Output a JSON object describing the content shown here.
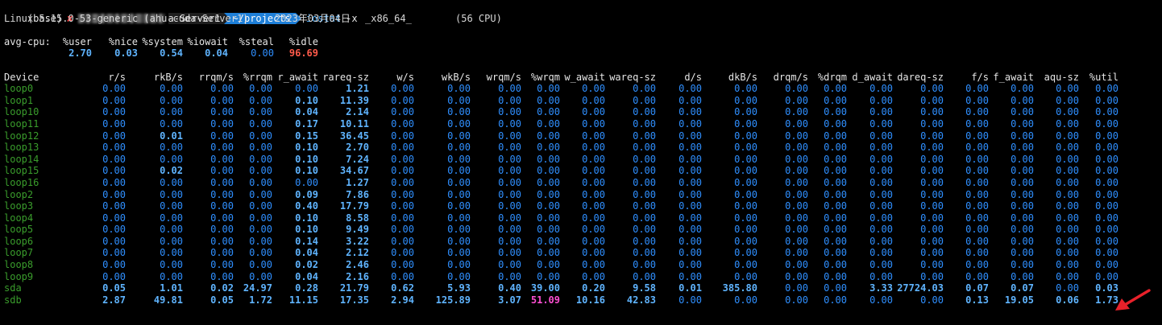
{
  "prompt": {
    "env": "(base)",
    "status_mark": "✘",
    "host_suffix": "a-Server1",
    "path": "~/projects",
    "command": "iostat",
    "args": "-x"
  },
  "sysinfo": {
    "kernel": "Linux 5.15.0-53-generic (ahu-cuda-Server1)",
    "date": "2023年03月04日",
    "arch": "_x86_64_",
    "cpus": "(56 CPU)"
  },
  "avgcpu": {
    "label": "avg-cpu:",
    "headers": [
      "%user",
      "%nice",
      "%system",
      "%iowait",
      "%steal",
      "%idle"
    ],
    "values": [
      "2.70",
      "0.03",
      "0.54",
      "0.04",
      "0.00",
      "96.69"
    ]
  },
  "device_header": "Device",
  "columns": [
    "r/s",
    "rkB/s",
    "rrqm/s",
    "%rrqm",
    "r_await",
    "rareq-sz",
    "w/s",
    "wkB/s",
    "wrqm/s",
    "%wrqm",
    "w_await",
    "wareq-sz",
    "d/s",
    "dkB/s",
    "drqm/s",
    "%drqm",
    "d_await",
    "dareq-sz",
    "f/s",
    "f_await",
    "aqu-sz",
    "%util"
  ],
  "devices": [
    {
      "name": "loop0",
      "v": [
        "0.00",
        "0.00",
        "0.00",
        "0.00",
        "0.00",
        "1.21",
        "0.00",
        "0.00",
        "0.00",
        "0.00",
        "0.00",
        "0.00",
        "0.00",
        "0.00",
        "0.00",
        "0.00",
        "0.00",
        "0.00",
        "0.00",
        "0.00",
        "0.00",
        "0.00"
      ]
    },
    {
      "name": "loop1",
      "v": [
        "0.00",
        "0.00",
        "0.00",
        "0.00",
        "0.10",
        "11.39",
        "0.00",
        "0.00",
        "0.00",
        "0.00",
        "0.00",
        "0.00",
        "0.00",
        "0.00",
        "0.00",
        "0.00",
        "0.00",
        "0.00",
        "0.00",
        "0.00",
        "0.00",
        "0.00"
      ]
    },
    {
      "name": "loop10",
      "v": [
        "0.00",
        "0.00",
        "0.00",
        "0.00",
        "0.04",
        "2.14",
        "0.00",
        "0.00",
        "0.00",
        "0.00",
        "0.00",
        "0.00",
        "0.00",
        "0.00",
        "0.00",
        "0.00",
        "0.00",
        "0.00",
        "0.00",
        "0.00",
        "0.00",
        "0.00"
      ]
    },
    {
      "name": "loop11",
      "v": [
        "0.00",
        "0.00",
        "0.00",
        "0.00",
        "0.17",
        "10.11",
        "0.00",
        "0.00",
        "0.00",
        "0.00",
        "0.00",
        "0.00",
        "0.00",
        "0.00",
        "0.00",
        "0.00",
        "0.00",
        "0.00",
        "0.00",
        "0.00",
        "0.00",
        "0.00"
      ]
    },
    {
      "name": "loop12",
      "v": [
        "0.00",
        "0.01",
        "0.00",
        "0.00",
        "0.15",
        "36.45",
        "0.00",
        "0.00",
        "0.00",
        "0.00",
        "0.00",
        "0.00",
        "0.00",
        "0.00",
        "0.00",
        "0.00",
        "0.00",
        "0.00",
        "0.00",
        "0.00",
        "0.00",
        "0.00"
      ]
    },
    {
      "name": "loop13",
      "v": [
        "0.00",
        "0.00",
        "0.00",
        "0.00",
        "0.10",
        "2.70",
        "0.00",
        "0.00",
        "0.00",
        "0.00",
        "0.00",
        "0.00",
        "0.00",
        "0.00",
        "0.00",
        "0.00",
        "0.00",
        "0.00",
        "0.00",
        "0.00",
        "0.00",
        "0.00"
      ]
    },
    {
      "name": "loop14",
      "v": [
        "0.00",
        "0.00",
        "0.00",
        "0.00",
        "0.10",
        "7.24",
        "0.00",
        "0.00",
        "0.00",
        "0.00",
        "0.00",
        "0.00",
        "0.00",
        "0.00",
        "0.00",
        "0.00",
        "0.00",
        "0.00",
        "0.00",
        "0.00",
        "0.00",
        "0.00"
      ]
    },
    {
      "name": "loop15",
      "v": [
        "0.00",
        "0.02",
        "0.00",
        "0.00",
        "0.10",
        "34.67",
        "0.00",
        "0.00",
        "0.00",
        "0.00",
        "0.00",
        "0.00",
        "0.00",
        "0.00",
        "0.00",
        "0.00",
        "0.00",
        "0.00",
        "0.00",
        "0.00",
        "0.00",
        "0.00"
      ]
    },
    {
      "name": "loop16",
      "v": [
        "0.00",
        "0.00",
        "0.00",
        "0.00",
        "0.00",
        "1.27",
        "0.00",
        "0.00",
        "0.00",
        "0.00",
        "0.00",
        "0.00",
        "0.00",
        "0.00",
        "0.00",
        "0.00",
        "0.00",
        "0.00",
        "0.00",
        "0.00",
        "0.00",
        "0.00"
      ]
    },
    {
      "name": "loop2",
      "v": [
        "0.00",
        "0.00",
        "0.00",
        "0.00",
        "0.09",
        "7.86",
        "0.00",
        "0.00",
        "0.00",
        "0.00",
        "0.00",
        "0.00",
        "0.00",
        "0.00",
        "0.00",
        "0.00",
        "0.00",
        "0.00",
        "0.00",
        "0.00",
        "0.00",
        "0.00"
      ]
    },
    {
      "name": "loop3",
      "v": [
        "0.00",
        "0.00",
        "0.00",
        "0.00",
        "0.40",
        "17.79",
        "0.00",
        "0.00",
        "0.00",
        "0.00",
        "0.00",
        "0.00",
        "0.00",
        "0.00",
        "0.00",
        "0.00",
        "0.00",
        "0.00",
        "0.00",
        "0.00",
        "0.00",
        "0.00"
      ]
    },
    {
      "name": "loop4",
      "v": [
        "0.00",
        "0.00",
        "0.00",
        "0.00",
        "0.10",
        "8.58",
        "0.00",
        "0.00",
        "0.00",
        "0.00",
        "0.00",
        "0.00",
        "0.00",
        "0.00",
        "0.00",
        "0.00",
        "0.00",
        "0.00",
        "0.00",
        "0.00",
        "0.00",
        "0.00"
      ]
    },
    {
      "name": "loop5",
      "v": [
        "0.00",
        "0.00",
        "0.00",
        "0.00",
        "0.10",
        "9.49",
        "0.00",
        "0.00",
        "0.00",
        "0.00",
        "0.00",
        "0.00",
        "0.00",
        "0.00",
        "0.00",
        "0.00",
        "0.00",
        "0.00",
        "0.00",
        "0.00",
        "0.00",
        "0.00"
      ]
    },
    {
      "name": "loop6",
      "v": [
        "0.00",
        "0.00",
        "0.00",
        "0.00",
        "0.14",
        "3.22",
        "0.00",
        "0.00",
        "0.00",
        "0.00",
        "0.00",
        "0.00",
        "0.00",
        "0.00",
        "0.00",
        "0.00",
        "0.00",
        "0.00",
        "0.00",
        "0.00",
        "0.00",
        "0.00"
      ]
    },
    {
      "name": "loop7",
      "v": [
        "0.00",
        "0.00",
        "0.00",
        "0.00",
        "0.04",
        "2.12",
        "0.00",
        "0.00",
        "0.00",
        "0.00",
        "0.00",
        "0.00",
        "0.00",
        "0.00",
        "0.00",
        "0.00",
        "0.00",
        "0.00",
        "0.00",
        "0.00",
        "0.00",
        "0.00"
      ]
    },
    {
      "name": "loop8",
      "v": [
        "0.00",
        "0.00",
        "0.00",
        "0.00",
        "0.02",
        "2.46",
        "0.00",
        "0.00",
        "0.00",
        "0.00",
        "0.00",
        "0.00",
        "0.00",
        "0.00",
        "0.00",
        "0.00",
        "0.00",
        "0.00",
        "0.00",
        "0.00",
        "0.00",
        "0.00"
      ]
    },
    {
      "name": "loop9",
      "v": [
        "0.00",
        "0.00",
        "0.00",
        "0.00",
        "0.04",
        "2.16",
        "0.00",
        "0.00",
        "0.00",
        "0.00",
        "0.00",
        "0.00",
        "0.00",
        "0.00",
        "0.00",
        "0.00",
        "0.00",
        "0.00",
        "0.00",
        "0.00",
        "0.00",
        "0.00"
      ]
    },
    {
      "name": "sda",
      "v": [
        "0.05",
        "1.01",
        "0.02",
        "24.97",
        "0.28",
        "21.79",
        "0.62",
        "5.93",
        "0.40",
        "39.00",
        "0.20",
        "9.58",
        "0.01",
        "385.80",
        "0.00",
        "0.00",
        "3.33",
        "27724.03",
        "0.07",
        "0.07",
        "0.00",
        "0.03"
      ]
    },
    {
      "name": "sdb",
      "v": [
        "2.87",
        "49.81",
        "0.05",
        "1.72",
        "11.15",
        "17.35",
        "2.94",
        "125.89",
        "3.07",
        "51.09",
        "10.16",
        "42.83",
        "0.00",
        "0.00",
        "0.00",
        "0.00",
        "0.00",
        "0.00",
        "0.13",
        "19.05",
        "0.06",
        "1.73"
      ]
    }
  ],
  "colors": {
    "device_name": "#3a9d2c",
    "zero_value": "#2f8fff",
    "nonzero_value": "#5fb4ff",
    "highlight_value": "#ff4fd3",
    "idle_value": "#ff5a4a",
    "annotation_arrow": "#e8212a"
  }
}
